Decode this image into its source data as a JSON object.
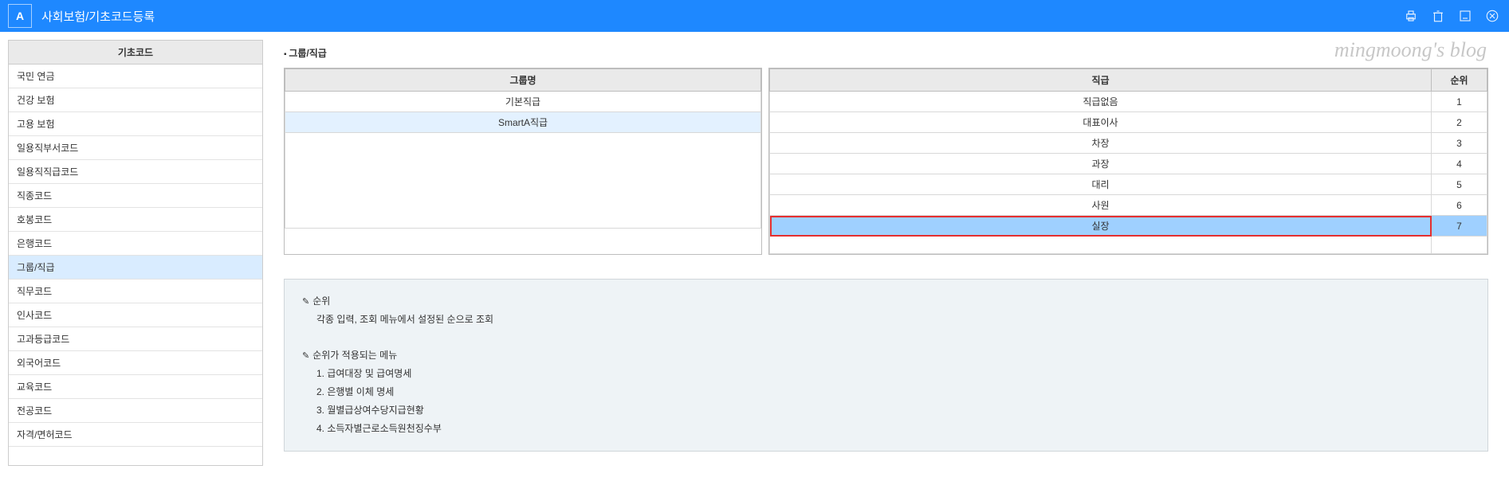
{
  "header": {
    "logo_text": "A",
    "title": "사회보험/기초코드등록"
  },
  "sidebar": {
    "header": "기초코드",
    "items": [
      "국민 연금",
      "건강 보험",
      "고용 보험",
      "일용직부서코드",
      "일용직직급코드",
      "직종코드",
      "호봉코드",
      "은행코드",
      "그룹/직급",
      "직무코드",
      "인사코드",
      "고과등급코드",
      "외국어코드",
      "교육코드",
      "전공코드",
      "자격/면허코드"
    ],
    "selected_index": 8
  },
  "main": {
    "watermark": "mingmoong's blog",
    "section_title": "그룹/직급",
    "group_table": {
      "header": "그룹명",
      "rows": [
        "기본직급",
        "SmartA직급"
      ],
      "selected_index": 1
    },
    "rank_table": {
      "headers": [
        "직급",
        "순위"
      ],
      "rows": [
        {
          "name": "직급없음",
          "rank": "1"
        },
        {
          "name": "대표이사",
          "rank": "2"
        },
        {
          "name": "차장",
          "rank": "3"
        },
        {
          "name": "과장",
          "rank": "4"
        },
        {
          "name": "대리",
          "rank": "5"
        },
        {
          "name": "사원",
          "rank": "6"
        },
        {
          "name": "실장",
          "rank": "7"
        }
      ],
      "highlight_index": 6
    },
    "help": {
      "h1": "순위",
      "h1_text": "각종 입력, 조회 메뉴에서 설정된 순으로 조회",
      "h2": "순위가 적용되는 메뉴",
      "items": [
        "1. 급여대장 및 급여명세",
        "2. 은행별 이체 명세",
        "3. 월별급상여수당지급현황",
        "4. 소득자별근로소득원천징수부"
      ]
    }
  }
}
